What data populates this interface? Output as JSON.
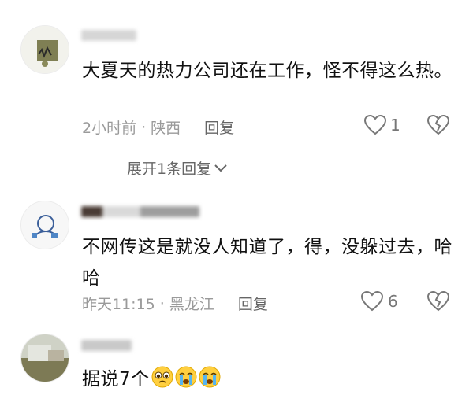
{
  "comments": [
    {
      "text": "大夏天的热力公司还在工作，怪不得这么热。",
      "time": "2小时前",
      "region": "陕西",
      "reply_label": "回复",
      "likes": "1"
    },
    {
      "text": "不网传这是就没人知道了，得，没躲过去，哈哈",
      "time": "昨天11:15",
      "region": "黑龙江",
      "reply_label": "回复",
      "likes": "6"
    },
    {
      "text": "据说7个",
      "emoji": [
        "pleading-face",
        "crying-face",
        "crying-face"
      ]
    }
  ],
  "expand_replies": "展开1条回复",
  "separator_dot": "·",
  "colors": {
    "meta_gray": "#9a9a9a",
    "text": "#111111",
    "icon_gray": "#777777"
  }
}
